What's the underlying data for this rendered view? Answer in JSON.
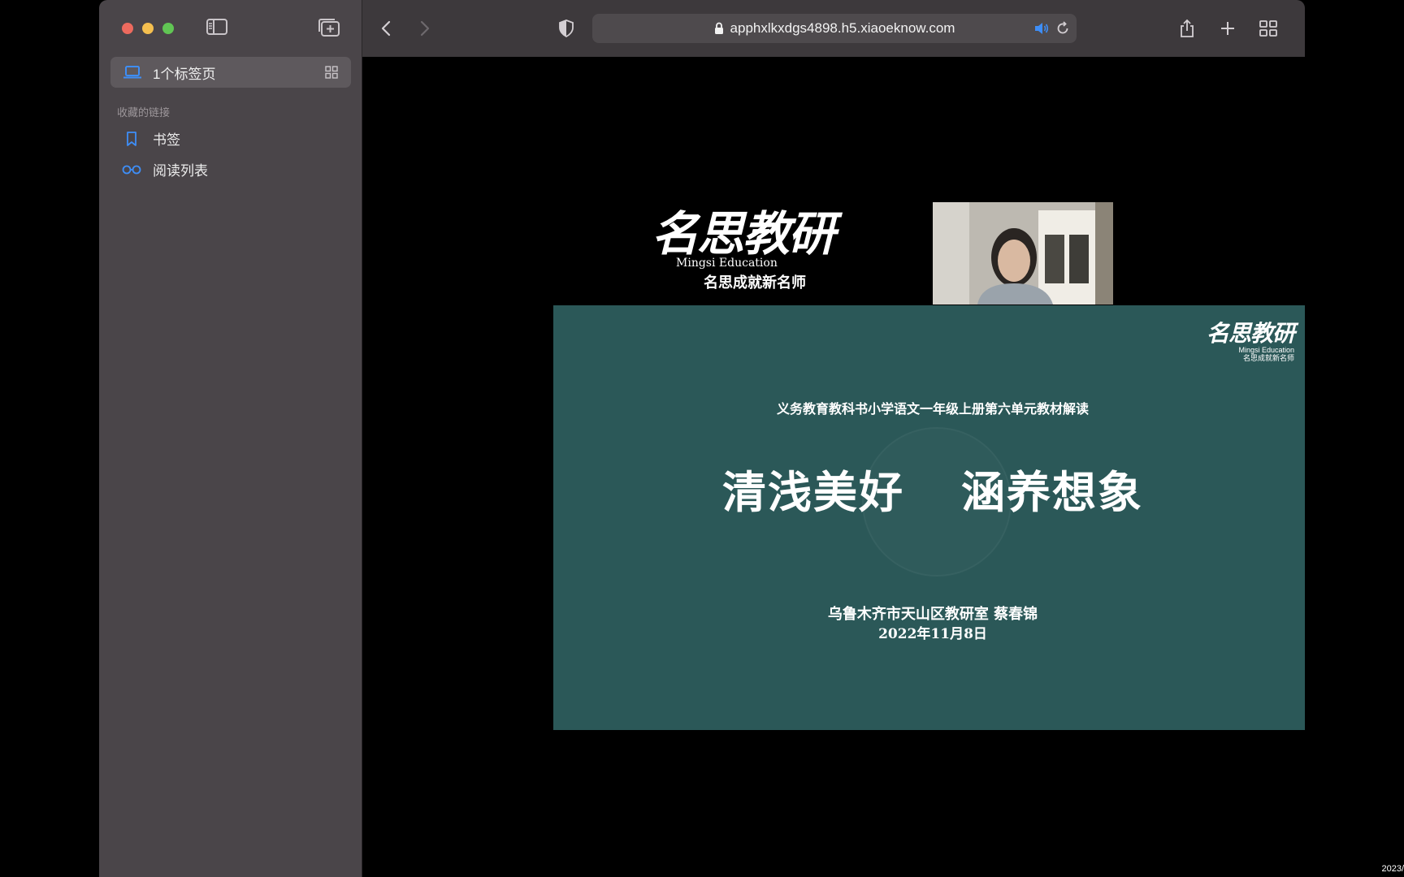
{
  "sidebar": {
    "tab_group_label": "1个标签页",
    "section_title": "收藏的链接",
    "items": [
      {
        "label": "书签",
        "icon": "bookmark-icon"
      },
      {
        "label": "阅读列表",
        "icon": "reading-list-icon"
      }
    ]
  },
  "toolbar": {
    "url": "apphxlkxdgs4898.h5.xiaoeknow.com"
  },
  "brand": {
    "calligraphy": "名思教研",
    "english": "Mingsi Education",
    "slogan": "名思成就新名师"
  },
  "slide": {
    "logo_calligraphy": "名思教研",
    "logo_english": "Mingsi Education",
    "logo_slogan": "名思成就新名师",
    "subtitle": "义务教育教科书小学语文一年级上册第六单元教材解读",
    "title_part1": "清浅美好",
    "title_part2": "涵养想象",
    "author": "乌鲁木齐市天山区教研室  蔡春锦",
    "date": "2022年11月8日"
  },
  "corner_text": "2023/",
  "colors": {
    "sidebar_bg": "#4a4549",
    "toolbar_bg": "#3d393c",
    "slide_bg": "#2b5858",
    "accent_blue": "#3e8ef7"
  }
}
